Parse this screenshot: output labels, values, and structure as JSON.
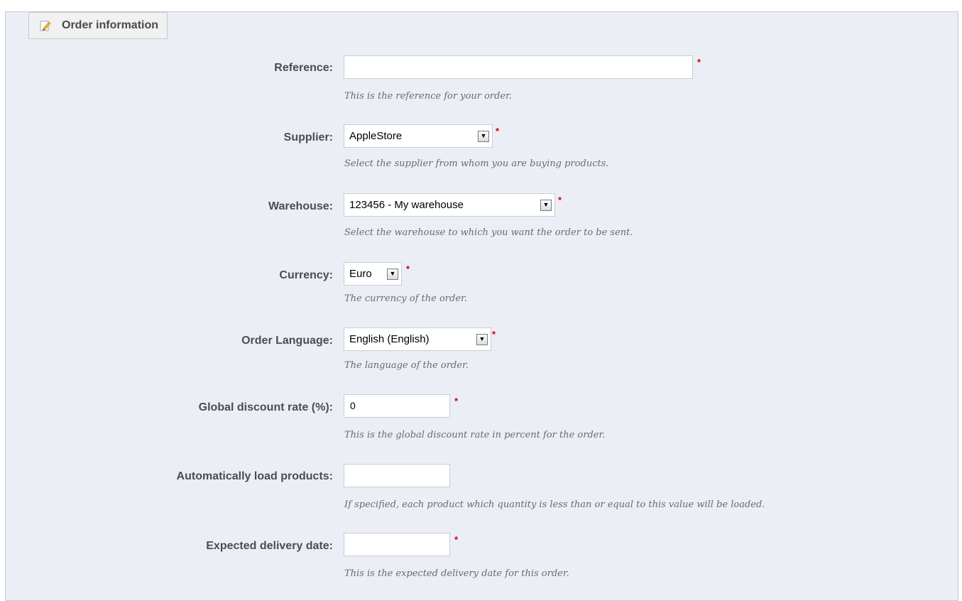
{
  "section": {
    "title": "Order information",
    "icon": "pencil-icon"
  },
  "fields": {
    "reference": {
      "label": "Reference:",
      "value": "",
      "required": "*",
      "hint": "This is the reference for your order."
    },
    "supplier": {
      "label": "Supplier:",
      "value": "AppleStore",
      "required": "*",
      "hint": "Select the supplier from whom you are buying products."
    },
    "warehouse": {
      "label": "Warehouse:",
      "value": "123456 - My warehouse",
      "required": "*",
      "hint": "Select the warehouse to which you want the order to be sent."
    },
    "currency": {
      "label": "Currency:",
      "value": "Euro",
      "required": "*",
      "hint": "The currency of the order."
    },
    "language": {
      "label": "Order Language:",
      "value": "English (English)",
      "required": "*",
      "hint": "The language of the order."
    },
    "discount": {
      "label": "Global discount rate (%):",
      "value": "0",
      "required": "*",
      "hint": "This is the global discount rate in percent for the order."
    },
    "autoload": {
      "label": "Automatically load products:",
      "value": "",
      "hint": "If specified, each product which quantity is less than or equal to this value will be loaded."
    },
    "delivery": {
      "label": "Expected delivery date:",
      "value": "",
      "required": "*",
      "hint": "This is the expected delivery date for this order."
    }
  },
  "colors": {
    "panel_bg": "#eceef6",
    "required": "#d00000"
  }
}
